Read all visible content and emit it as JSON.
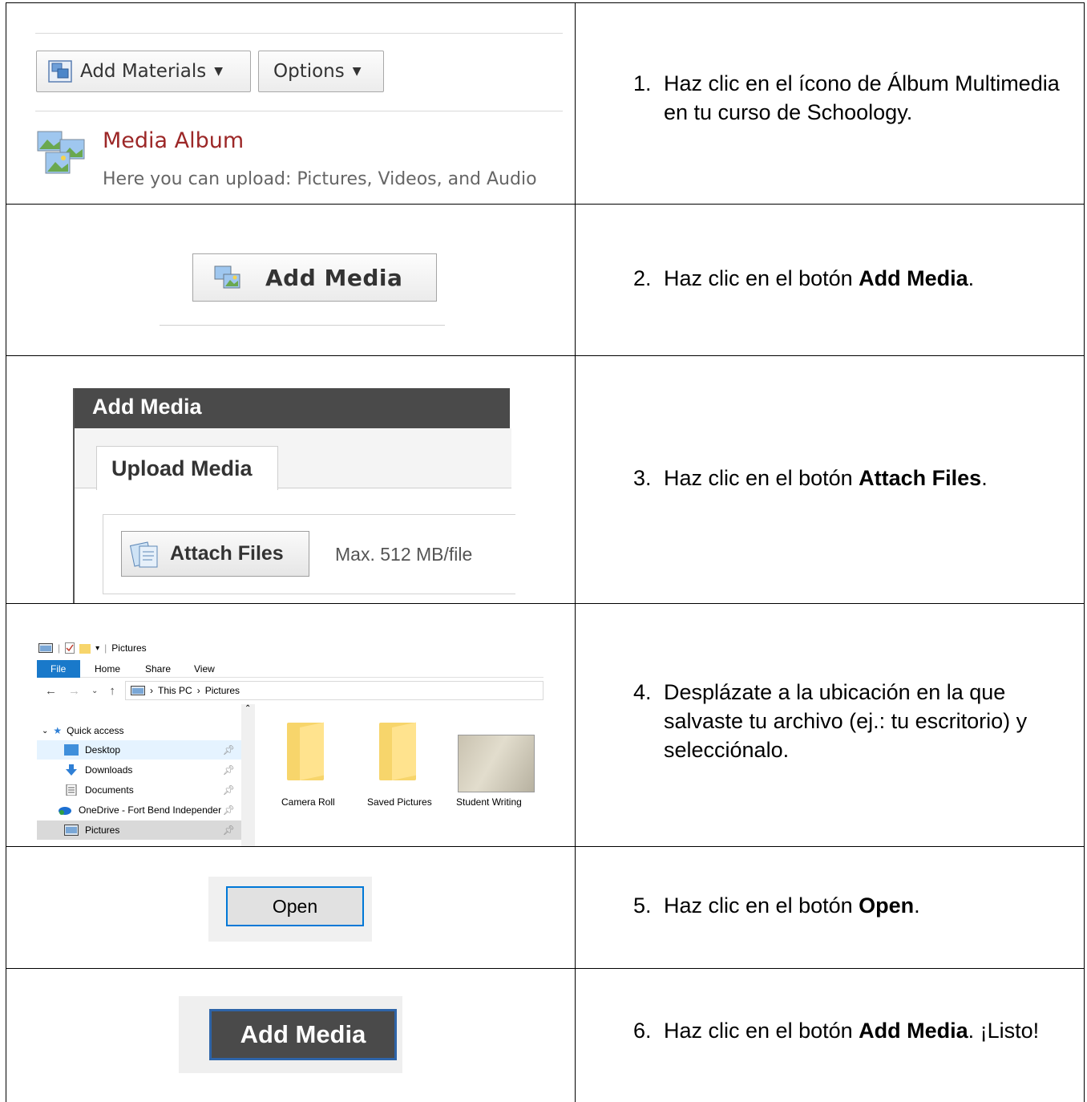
{
  "row1": {
    "add_materials": "Add Materials",
    "options": "Options",
    "media_title": "Media Album",
    "media_subtitle": "Here you can upload: Pictures, Videos, and Audio",
    "step_number": "1.",
    "step_text": "Haz clic en el ícono de Álbum Multimedia en tu curso de Schoology."
  },
  "row2": {
    "button": "Add Media",
    "step_number": "2.",
    "step_prefix": "Haz clic en el botón ",
    "step_bold": "Add Media",
    "step_suffix": "."
  },
  "row3": {
    "dialog_title": "Add Media",
    "tab": "Upload Media",
    "attach_button": "Attach Files",
    "max_size": "Max. 512 MB/file",
    "step_number": "3.",
    "step_prefix": "Haz clic en el botón ",
    "step_bold": "Attach Files",
    "step_suffix": "."
  },
  "row4": {
    "window_title": "Pictures",
    "menu": {
      "file": "File",
      "home": "Home",
      "share": "Share",
      "view": "View"
    },
    "path": {
      "this_pc": "This PC",
      "sep": "›",
      "pictures": "Pictures"
    },
    "sidebar": {
      "quick_access": "Quick access",
      "items": [
        "Desktop",
        "Downloads",
        "Documents",
        "OneDrive - Fort Bend Independer",
        "Pictures"
      ]
    },
    "files": [
      "Camera Roll",
      "Saved Pictures",
      "Student Writing"
    ],
    "step_number": "4.",
    "step_text": "Desplázate a la ubicación en la que salvaste tu archivo (ej.: tu escritorio) y selecciónalo."
  },
  "row5": {
    "button": "Open",
    "step_number": "5.",
    "step_prefix": "Haz clic en el botón ",
    "step_bold": "Open",
    "step_suffix": "."
  },
  "row6": {
    "button": "Add Media",
    "step_number": "6.",
    "step_prefix": "Haz clic en el botón ",
    "step_bold": "Add Media",
    "step_suffix": ". ¡Listo!"
  }
}
